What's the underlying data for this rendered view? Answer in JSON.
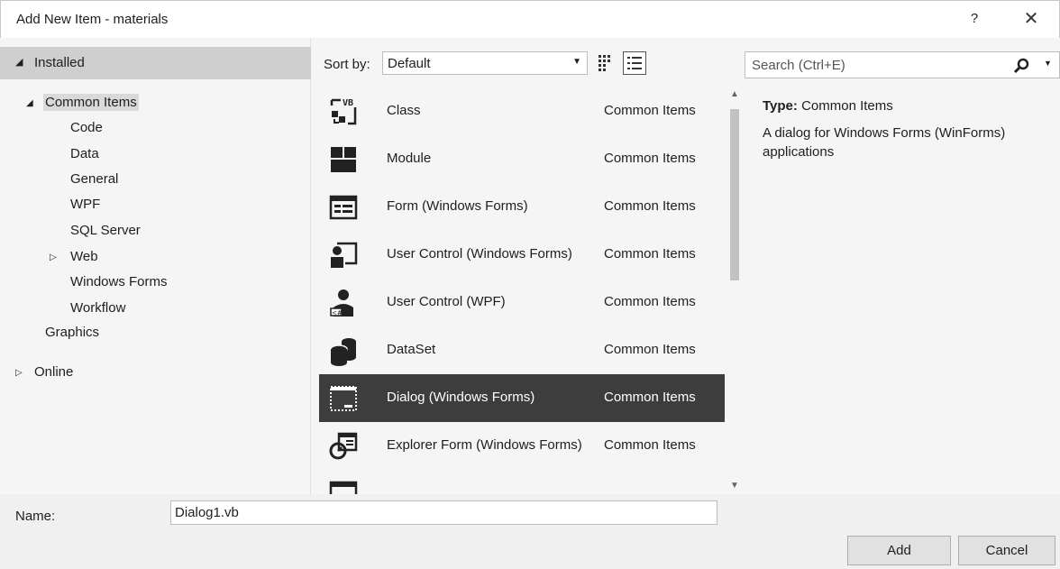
{
  "window": {
    "title": "Add New Item - materials",
    "help_label": "?",
    "close_label": "✕"
  },
  "tree": {
    "installed_label": "Installed",
    "common_items_label": "Common Items",
    "children": [
      "Code",
      "Data",
      "General",
      "WPF",
      "SQL Server",
      "Web",
      "Windows Forms",
      "Workflow"
    ],
    "graphics_label": "Graphics",
    "online_label": "Online"
  },
  "toolbar": {
    "sort_label": "Sort by:",
    "sort_value": "Default"
  },
  "search": {
    "placeholder": "Search (Ctrl+E)"
  },
  "items": [
    {
      "name": "Class",
      "category": "Common Items",
      "icon": "class-vb-icon"
    },
    {
      "name": "Module",
      "category": "Common Items",
      "icon": "module-icon"
    },
    {
      "name": "Form (Windows Forms)",
      "category": "Common Items",
      "icon": "form-icon"
    },
    {
      "name": "User Control (Windows Forms)",
      "category": "Common Items",
      "icon": "user-control-icon"
    },
    {
      "name": "User Control (WPF)",
      "category": "Common Items",
      "icon": "user-control-wpf-icon"
    },
    {
      "name": "DataSet",
      "category": "Common Items",
      "icon": "dataset-icon"
    },
    {
      "name": "Dialog (Windows Forms)",
      "category": "Common Items",
      "icon": "dialog-icon",
      "selected": true
    },
    {
      "name": "Explorer Form (Windows Forms)",
      "category": "Common Items",
      "icon": "explorer-form-icon"
    }
  ],
  "details": {
    "type_label": "Type:",
    "type_value": "Common Items",
    "description": "A dialog for Windows Forms (WinForms) applications"
  },
  "footer": {
    "name_label": "Name:",
    "name_value": "Dialog1.vb",
    "add_label": "Add",
    "cancel_label": "Cancel"
  }
}
